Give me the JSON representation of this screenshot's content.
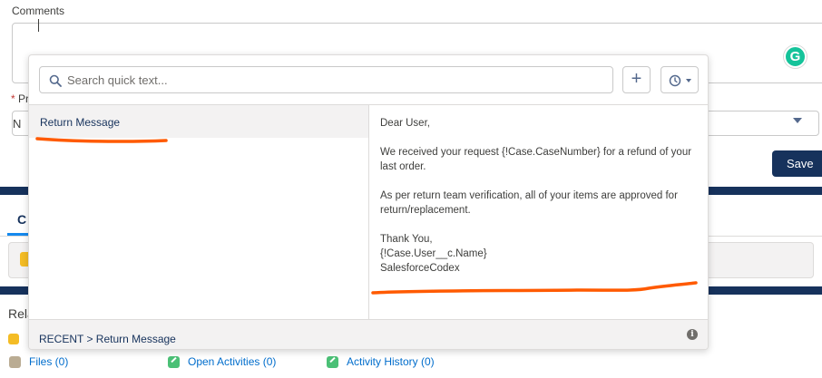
{
  "form": {
    "comments_label": "Comments",
    "priority_required": "*",
    "priority_label_fragment": "Pr",
    "priority_value_fragment": "N",
    "save_button": "Save"
  },
  "tabs": {
    "active_fragment": "C"
  },
  "related": {
    "heading_fragment": "Rela"
  },
  "bottom_links": [
    {
      "label": "Files (0)",
      "icon": "files-icon"
    },
    {
      "label": "Open Activities (0)",
      "icon": "activity-icon"
    },
    {
      "label": "Activity History (0)",
      "icon": "activity-icon"
    }
  ],
  "quick_text": {
    "search_placeholder": "Search quick text...",
    "items": [
      {
        "label": "Return Message",
        "selected": true
      }
    ],
    "preview_lines": [
      "Dear User,",
      "We received your request {!Case.CaseNumber} for a refund of your",
      "last order.",
      "As per return team verification, all of your items are approved for",
      "return/replacement.",
      "Thank You,",
      "{!Case.User__c.Name}",
      "SalesforceCodex"
    ],
    "breadcrumb": "RECENT > Return Message",
    "info_glyph": "i"
  },
  "grammarly_glyph": "G",
  "colors": {
    "navy": "#16325c",
    "link": "#006dcc",
    "annotation": "#ff5a00",
    "grammarly": "#15c39a"
  }
}
